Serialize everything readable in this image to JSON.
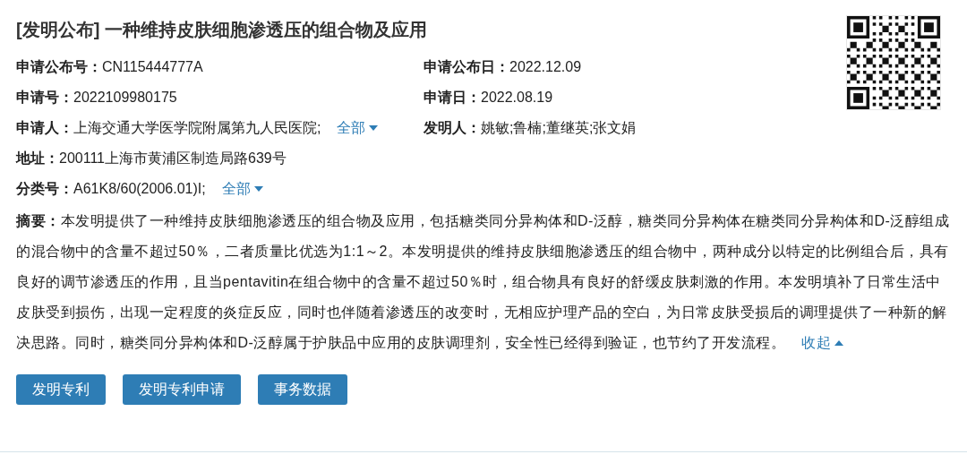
{
  "title": "[发明公布] 一种维持皮肤细胞渗透压的组合物及应用",
  "rows": [
    [
      {
        "label": "申请公布号：",
        "value": "CN115444777A"
      },
      {
        "label": "申请公布日：",
        "value": "2022.12.09"
      }
    ],
    [
      {
        "label": "申请号：",
        "value": "2022109980175"
      },
      {
        "label": "申请日：",
        "value": "2022.08.19"
      }
    ],
    [
      {
        "label": "申请人：",
        "value": "上海交通大学医学院附属第九人民医院;",
        "toggle": {
          "label": "全部",
          "expanded": false
        }
      },
      {
        "label": "发明人：",
        "value": "姚敏;鲁楠;董继英;张文娟"
      }
    ],
    [
      {
        "label": "地址：",
        "value": "200111上海市黄浦区制造局路639号"
      }
    ],
    [
      {
        "label": "分类号：",
        "value": "A61K8/60(2006.01)I;",
        "toggle": {
          "label": "全部",
          "expanded": false
        }
      }
    ]
  ],
  "abstract": {
    "text": "**摘要：**本发明提供了一种维持皮肤细胞渗透压的组合物及应用，包括糖类同分异构体和D-泛醇，糖类同分异构体在糖类同分异构体和D-泛醇组成的混合物中的含量不超过50％，二者质量比优选为1:1～2。本发明提供的维持皮肤细胞渗透压的组合物中，两种成分以特定的比例组合后，具有良好的调节渗透压的作用，且当pentavitin在组合物中的含量不超过50％时，组合物具有良好的舒缓皮肤刺激的作用。本发明填补了日常生活中皮肤受到损伤，出现一定程度的炎症反应，同时也伴随着渗透压的改变时，无相应护理产品的空白，为日常皮肤受损后的调理提供了一种新的解决思路。同时，糖类同分异构体和D-泛醇属于护肤品中应用的皮肤调理剂，安全性已经得到验证，也节约了开发流程。",
    "toggle": {
      "label": "收起",
      "expanded": true
    }
  },
  "buttons": [
    "发明专利",
    "发明专利申请",
    "事务数据"
  ]
}
